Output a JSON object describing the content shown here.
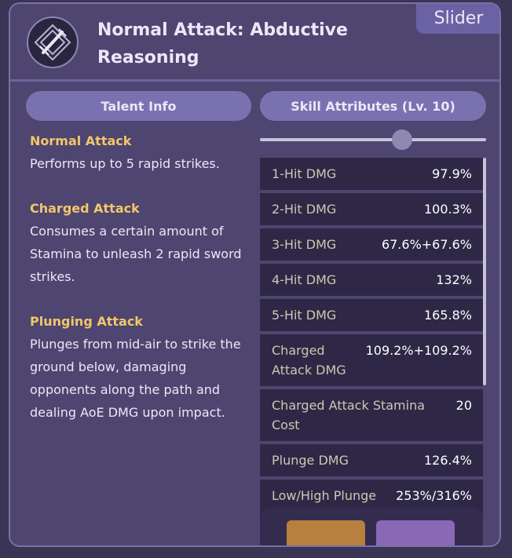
{
  "header": {
    "title": "Normal Attack: Abductive Reasoning",
    "tag": "Slider",
    "emblem_icon": "crossed-swords-icon"
  },
  "tabs": {
    "talent_info": "Talent Info",
    "skill_attributes": "Skill Attributes (Lv. 10)"
  },
  "talent_info": {
    "sections": [
      {
        "title": "Normal Attack",
        "text": "Performs up to 5 rapid strikes."
      },
      {
        "title": "Charged Attack",
        "text": "Consumes a certain amount of Stamina to unleash 2 rapid sword strikes."
      },
      {
        "title": "Plunging Attack",
        "text": "Plunges from mid-air to strike the ground below, damaging opponents along the path and dealing AoE DMG upon impact."
      }
    ]
  },
  "level_slider": {
    "value_fraction": 0.63
  },
  "attributes": [
    {
      "name": "1-Hit DMG",
      "value": "97.9%"
    },
    {
      "name": "2-Hit DMG",
      "value": "100.3%"
    },
    {
      "name": "3-Hit DMG",
      "value": "67.6%+67.6%"
    },
    {
      "name": "4-Hit DMG",
      "value": "132%"
    },
    {
      "name": "5-Hit DMG",
      "value": "165.8%"
    },
    {
      "name": "Charged Attack DMG",
      "value": "109.2%+109.2%"
    },
    {
      "name": "Charged Attack Stamina Cost",
      "value": "20"
    },
    {
      "name": "Plunge DMG",
      "value": "126.4%"
    },
    {
      "name": "Low/High Plunge DMG",
      "value": "253%/316%"
    }
  ],
  "colors": {
    "accent": "#f3c66a",
    "card": "#4e4670",
    "tab": "#7a72b0"
  }
}
